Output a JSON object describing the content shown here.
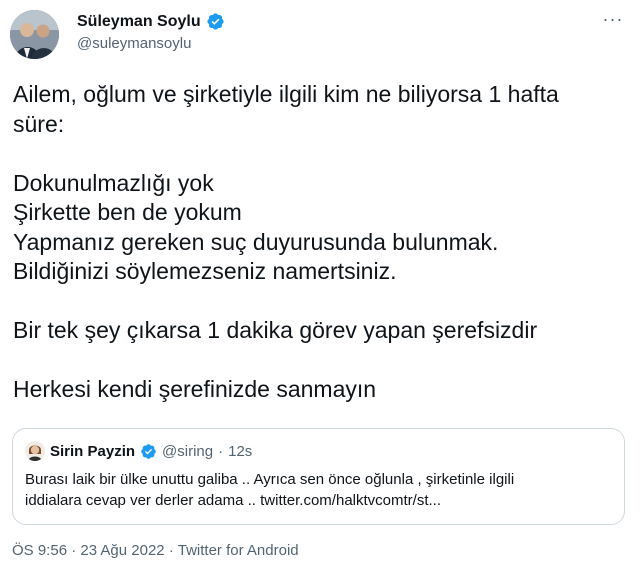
{
  "author": {
    "name": "Süleyman Soylu",
    "handle": "@suleymansoylu",
    "verified": true
  },
  "more_icon": "more-horizontal-icon",
  "body": {
    "paragraph1": [
      "Ailem, oğlum ve şirketiyle ilgili kim ne biliyorsa 1 hafta",
      "süre:"
    ],
    "paragraph2": [
      "Dokunulmazlığı yok",
      "Şirkette ben de yokum",
      "Yapmanız gereken suç duyurusunda bulunmak.",
      "Bildiğinizi söylemezseniz namertsiniz."
    ],
    "paragraph3": [
      "Bir tek şey çıkarsa 1 dakika görev yapan şerefsizdir"
    ],
    "paragraph4": [
      "Herkesi kendi şerefinizde sanmayın"
    ]
  },
  "quote": {
    "name": "Sirin Payzin",
    "handle": "@siring",
    "separator": "·",
    "time": "12s",
    "verified": true,
    "text": [
      "Burası laik bir ülke unuttu galiba .. Ayrıca sen önce oğlunla , şirketinle ilgili",
      "iddialara cevap ver derler adama .. twitter.com/halktvcomtr/st..."
    ]
  },
  "meta": {
    "time": "ÖS 9:56",
    "separator1": "·",
    "date": "23 Ağu 2022",
    "separator2": "·",
    "source": "Twitter for Android"
  },
  "colors": {
    "text": "#0f1419",
    "secondary": "#536471",
    "verified": "#1d9bf0",
    "border": "#cfd9de"
  }
}
